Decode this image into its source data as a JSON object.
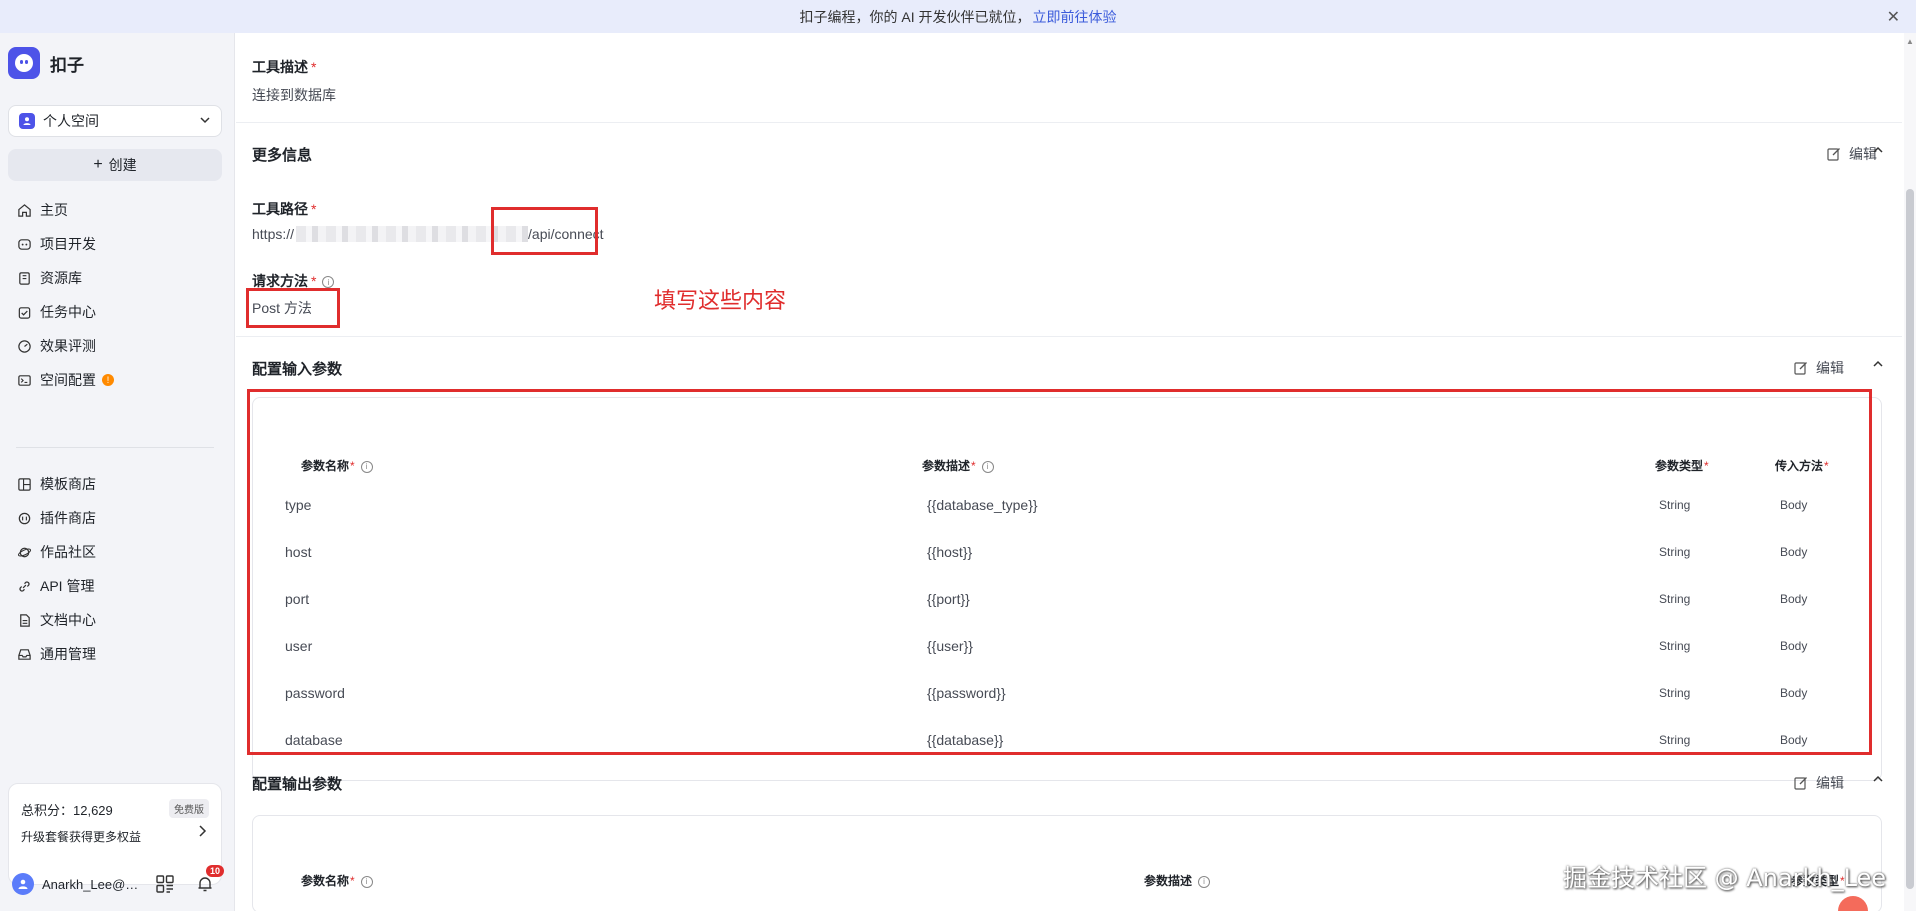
{
  "banner": {
    "text": "扣子编程，你的 AI 开发伙伴已就位，",
    "link": "立即前往体验",
    "close_icon": "close-icon"
  },
  "sidebar": {
    "brand": "扣子",
    "space": "个人空间",
    "create": "创建",
    "items": [
      {
        "label": "主页",
        "icon": "home-icon"
      },
      {
        "label": "项目开发",
        "icon": "bot-icon"
      },
      {
        "label": "资源库",
        "icon": "library-icon"
      },
      {
        "label": "任务中心",
        "icon": "task-icon"
      },
      {
        "label": "效果评测",
        "icon": "gauge-icon"
      },
      {
        "label": "空间配置",
        "icon": "terminal-icon",
        "badge": "!"
      }
    ],
    "items2": [
      {
        "label": "模板商店",
        "icon": "template-icon"
      },
      {
        "label": "插件商店",
        "icon": "plugin-icon"
      },
      {
        "label": "作品社区",
        "icon": "planet-icon"
      },
      {
        "label": "API 管理",
        "icon": "link-icon"
      },
      {
        "label": "文档中心",
        "icon": "doc-icon"
      },
      {
        "label": "通用管理",
        "icon": "inbox-icon"
      }
    ],
    "points": {
      "label": "总积分：12,629",
      "badge": "免费版",
      "upgrade": "升级套餐获得更多权益"
    },
    "user": {
      "name": "Anarkh_Lee@…",
      "notifications": "10"
    }
  },
  "main": {
    "tool_desc_label": "工具描述",
    "tool_desc_value": "连接到数据库",
    "more_info_title": "更多信息",
    "edit_label": "编辑",
    "tool_path_label": "工具路径",
    "tool_path_prefix": "https://",
    "tool_path_suffix": "/api/connect",
    "method_label": "请求方法",
    "method_value": "Post 方法",
    "annotation": "填写这些内容",
    "input_params_title": "配置输入参数",
    "input_columns": [
      "参数名称",
      "参数描述",
      "参数类型",
      "传入方法"
    ],
    "input_rows": [
      {
        "name": "type",
        "desc": "{{database_type}}",
        "type": "String",
        "method": "Body"
      },
      {
        "name": "host",
        "desc": "{{host}}",
        "type": "String",
        "method": "Body"
      },
      {
        "name": "port",
        "desc": "{{port}}",
        "type": "String",
        "method": "Body"
      },
      {
        "name": "user",
        "desc": "{{user}}",
        "type": "String",
        "method": "Body"
      },
      {
        "name": "password",
        "desc": "{{password}}",
        "type": "String",
        "method": "Body"
      },
      {
        "name": "database",
        "desc": "{{database}}",
        "type": "String",
        "method": "Body"
      }
    ],
    "output_params_title": "配置输出参数",
    "output_columns": [
      "参数名称",
      "参数描述",
      "参数类型"
    ]
  },
  "watermark": "掘金技术社区 @ Anarkh_Lee"
}
